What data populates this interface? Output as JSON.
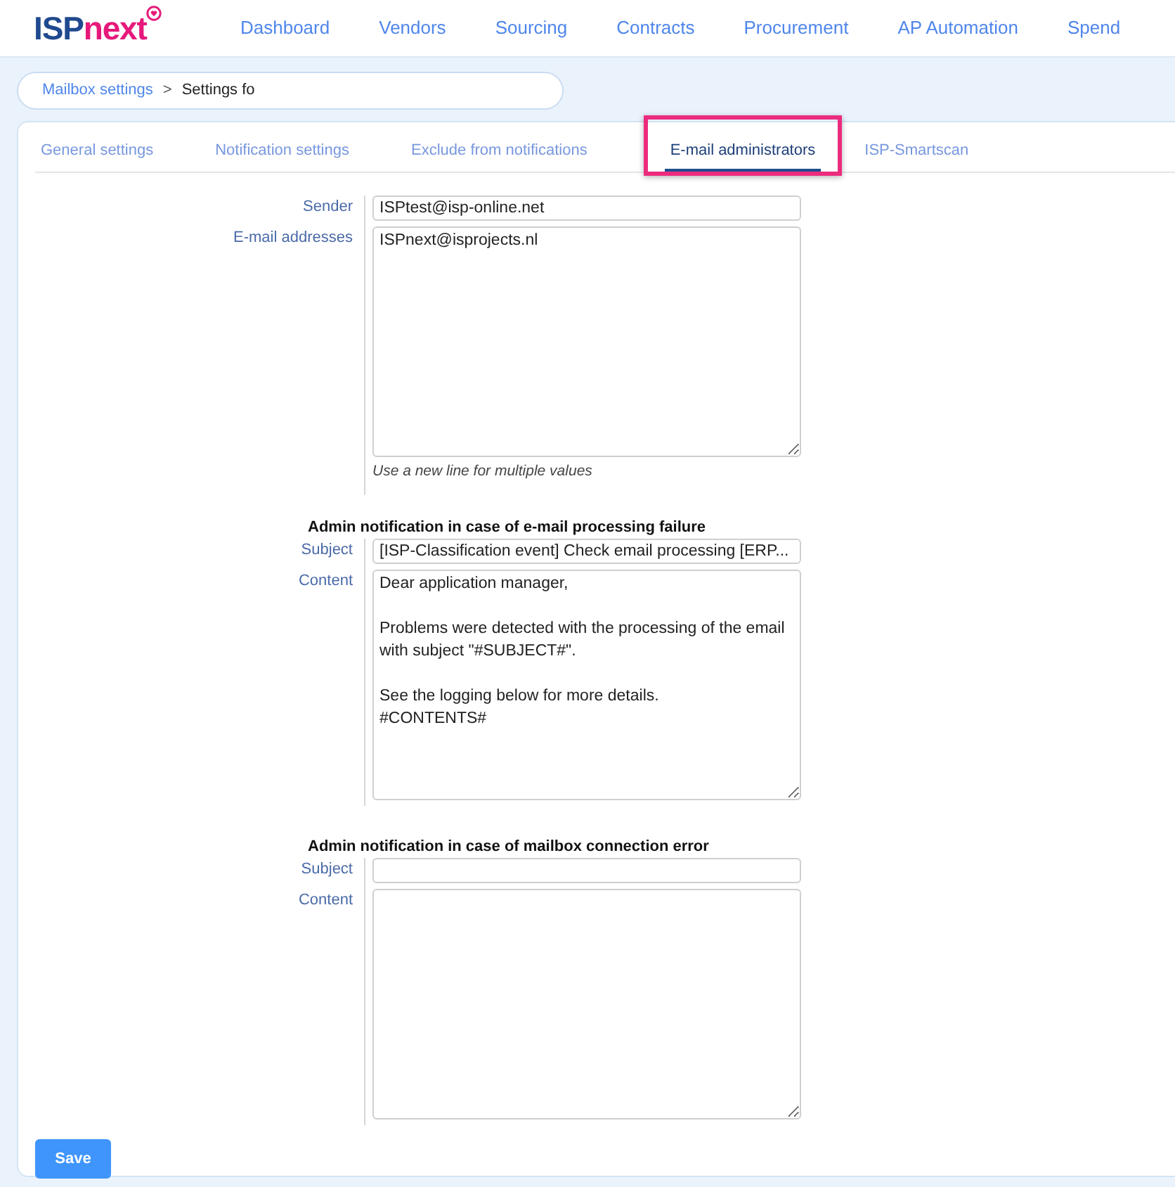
{
  "logo": {
    "prefix": "ISP",
    "suffix": "next"
  },
  "nav": [
    "Dashboard",
    "Vendors",
    "Sourcing",
    "Contracts",
    "Procurement",
    "AP Automation",
    "Spend"
  ],
  "breadcrumb": {
    "link": "Mailbox settings",
    "separator": ">",
    "current": "Settings fo"
  },
  "tabs": [
    {
      "label": "General settings",
      "selected": false,
      "highlighted": false
    },
    {
      "label": "Notification settings",
      "selected": false,
      "highlighted": false
    },
    {
      "label": "Exclude from notifications",
      "selected": false,
      "highlighted": false
    },
    {
      "label": "E-mail administrators",
      "selected": true,
      "highlighted": true
    },
    {
      "label": "ISP-Smartscan",
      "selected": false,
      "highlighted": false
    }
  ],
  "sender": {
    "label": "Sender",
    "value": "ISPtest@isp-online.net"
  },
  "email_addresses": {
    "label": "E-mail addresses",
    "value": "ISPnext@isprojects.nl",
    "hint": "Use a new line for multiple values"
  },
  "sections": [
    {
      "heading": "Admin notification in case of e-mail processing failure",
      "subject_label": "Subject",
      "subject": "[ISP-Classification event] Check email processing [ERP...",
      "content_label": "Content",
      "content": "Dear application manager,\n\nProblems were detected with the processing of the email with subject \"#SUBJECT#\".\n\nSee the logging below for more details.\n#CONTENTS#"
    },
    {
      "heading": "Admin notification in case of mailbox connection error",
      "subject_label": "Subject",
      "content_label": "Content"
    }
  ],
  "save_button": "Save"
}
